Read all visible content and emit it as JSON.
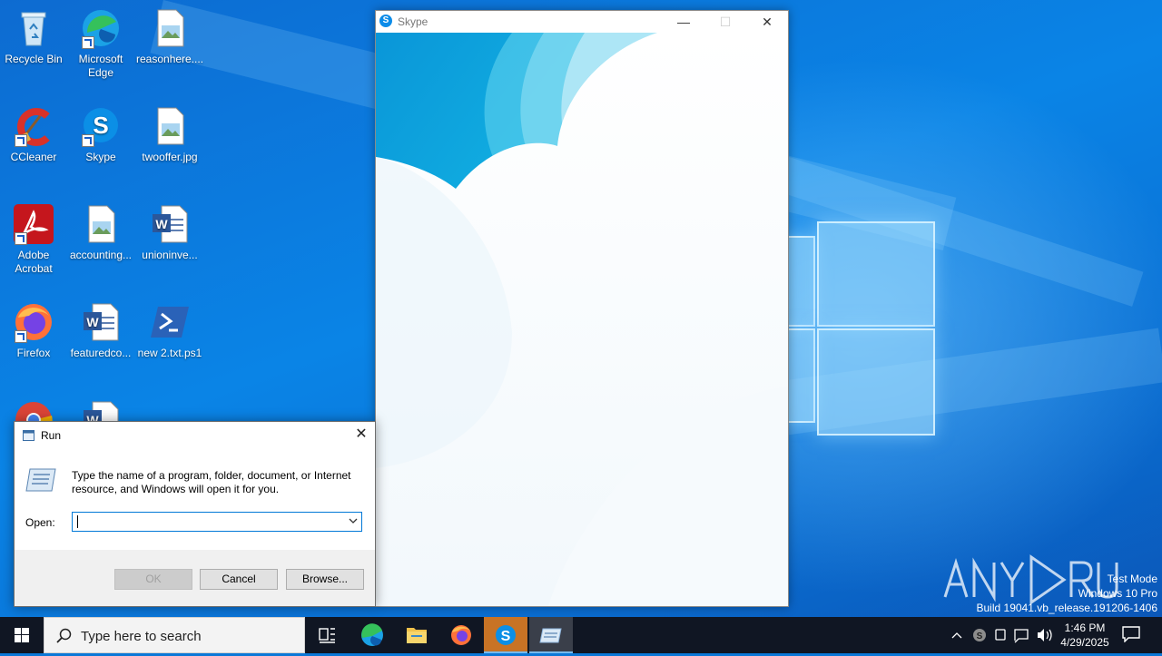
{
  "desktop": {
    "icons": [
      {
        "label": "Recycle Bin"
      },
      {
        "label": "Microsoft Edge"
      },
      {
        "label": "reasonhere...."
      },
      {
        "label": "CCleaner"
      },
      {
        "label": "Skype"
      },
      {
        "label": "twooffer.jpg"
      },
      {
        "label": "Adobe Acrobat"
      },
      {
        "label": "accounting..."
      },
      {
        "label": "unioninve..."
      },
      {
        "label": "Firefox"
      },
      {
        "label": "featuredco..."
      },
      {
        "label": "new 2.txt.ps1"
      }
    ]
  },
  "skype_window": {
    "title": "Skype",
    "minimize": "—",
    "maximize": "☐",
    "close": "✕"
  },
  "run_dialog": {
    "title": "Run",
    "description": "Type the name of a program, folder, document, or Internet resource, and Windows will open it for you.",
    "open_label": "Open:",
    "open_value": "",
    "ok_label": "OK",
    "cancel_label": "Cancel",
    "browse_label": "Browse..."
  },
  "taskbar": {
    "search_placeholder": "Type here to search",
    "time": "1:46 PM",
    "date": "4/29/2025"
  },
  "watermark": {
    "line1": "Test Mode",
    "line2": "Windows 10 Pro",
    "line3": "Build 19041.vb_release.191206-1406",
    "brand": "ANY RUN"
  }
}
